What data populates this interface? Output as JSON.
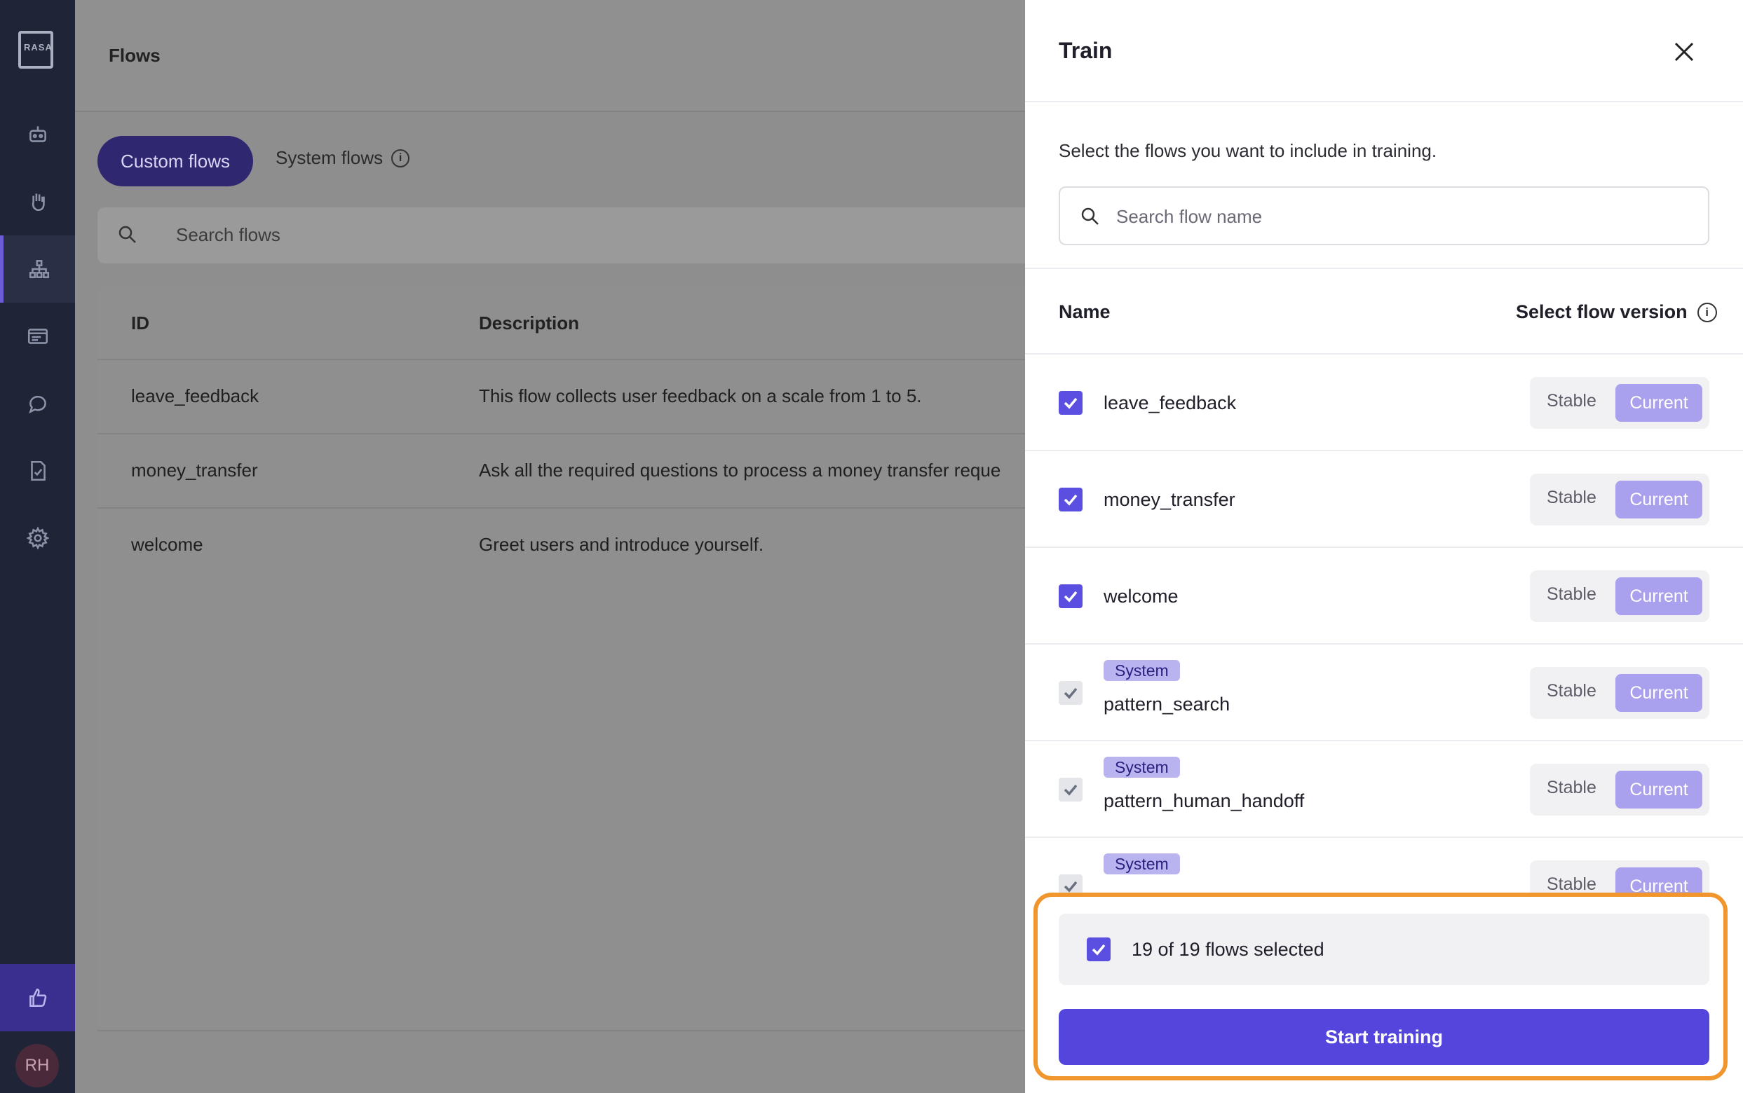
{
  "sidebar": {
    "logo_text": "RASA",
    "avatar_initials": "RH",
    "items": [
      {
        "icon": "robot-icon"
      },
      {
        "icon": "hand-icon"
      },
      {
        "icon": "flows-icon",
        "active": true
      },
      {
        "icon": "responses-icon"
      },
      {
        "icon": "chat-icon"
      },
      {
        "icon": "checklist-icon"
      },
      {
        "icon": "gear-icon"
      }
    ],
    "feedback_icon": "thumbs-up-icon"
  },
  "main": {
    "title": "Flows",
    "tabs": [
      {
        "label": "Custom flows",
        "active": true
      },
      {
        "label": "System flows"
      }
    ],
    "search_placeholder": "Search flows",
    "table": {
      "columns": [
        "ID",
        "Description"
      ],
      "rows": [
        {
          "id": "leave_feedback",
          "description": "This flow collects user feedback on a scale from 1 to 5."
        },
        {
          "id": "money_transfer",
          "description": "Ask all the required questions to process a money transfer reque"
        },
        {
          "id": "welcome",
          "description": "Greet users and introduce yourself."
        }
      ]
    }
  },
  "panel": {
    "title": "Train",
    "intro": "Select the flows you want to include in training.",
    "search_placeholder": "Search flow name",
    "col_name": "Name",
    "col_version": "Select flow version",
    "version_labels": {
      "stable": "Stable",
      "current": "Current"
    },
    "system_badge": "System",
    "flows": [
      {
        "name": "leave_feedback",
        "system": false,
        "selected_version": "Current"
      },
      {
        "name": "money_transfer",
        "system": false,
        "selected_version": "Current"
      },
      {
        "name": "welcome",
        "system": false,
        "selected_version": "Current"
      },
      {
        "name": "pattern_search",
        "system": true,
        "selected_version": "Current"
      },
      {
        "name": "pattern_human_handoff",
        "system": true,
        "selected_version": "Current"
      },
      {
        "name": "",
        "system": true,
        "selected_version": "Current"
      }
    ],
    "summary": "19 of 19 flows selected",
    "start_button": "Start training"
  },
  "colors": {
    "accent": "#5446dd",
    "highlight": "#f0962c",
    "sidebar_bg": "#1f2437"
  }
}
